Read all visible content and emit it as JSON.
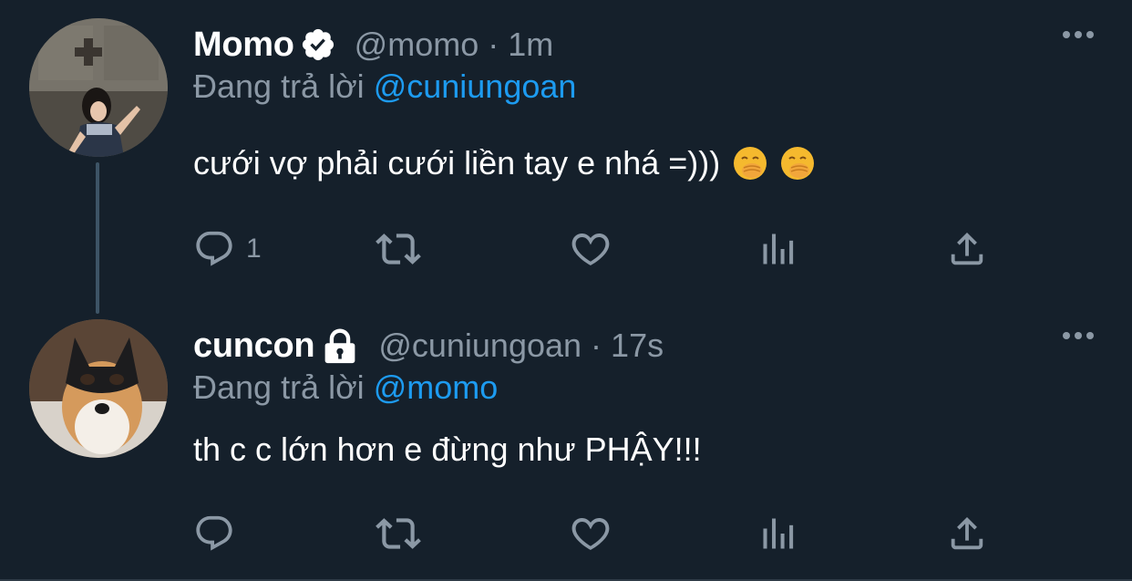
{
  "tweets": [
    {
      "display_name": "Momo",
      "handle": "@momo",
      "separator": "·",
      "time": "1m",
      "reply_prefix": "Đang trả lời",
      "reply_mention": "@cuniungoan",
      "text": "cưới vợ phải cưới liền tay e nhá =)))",
      "emojis": [
        "face-with-hand-over-mouth",
        "face-with-hand-over-mouth"
      ],
      "badge_icon": "verified-badge-icon",
      "reply_count": "1"
    },
    {
      "display_name": "cuncon",
      "handle": "@cuniungoan",
      "separator": "·",
      "time": "17s",
      "reply_prefix": "Đang trả lời",
      "reply_mention": "@momo",
      "text": "th c c lớn hơn e đừng như PHẬY!!!",
      "badge_icon": "lock-icon",
      "reply_count": ""
    }
  ],
  "colors": {
    "background": "#15202b",
    "text": "#ffffff",
    "muted": "#8b98a5",
    "accent": "#1d9bf0",
    "thread_line": "#3d5466"
  },
  "icons": [
    "reply-icon",
    "retweet-icon",
    "like-icon",
    "stats-icon",
    "share-icon",
    "more-icon"
  ]
}
